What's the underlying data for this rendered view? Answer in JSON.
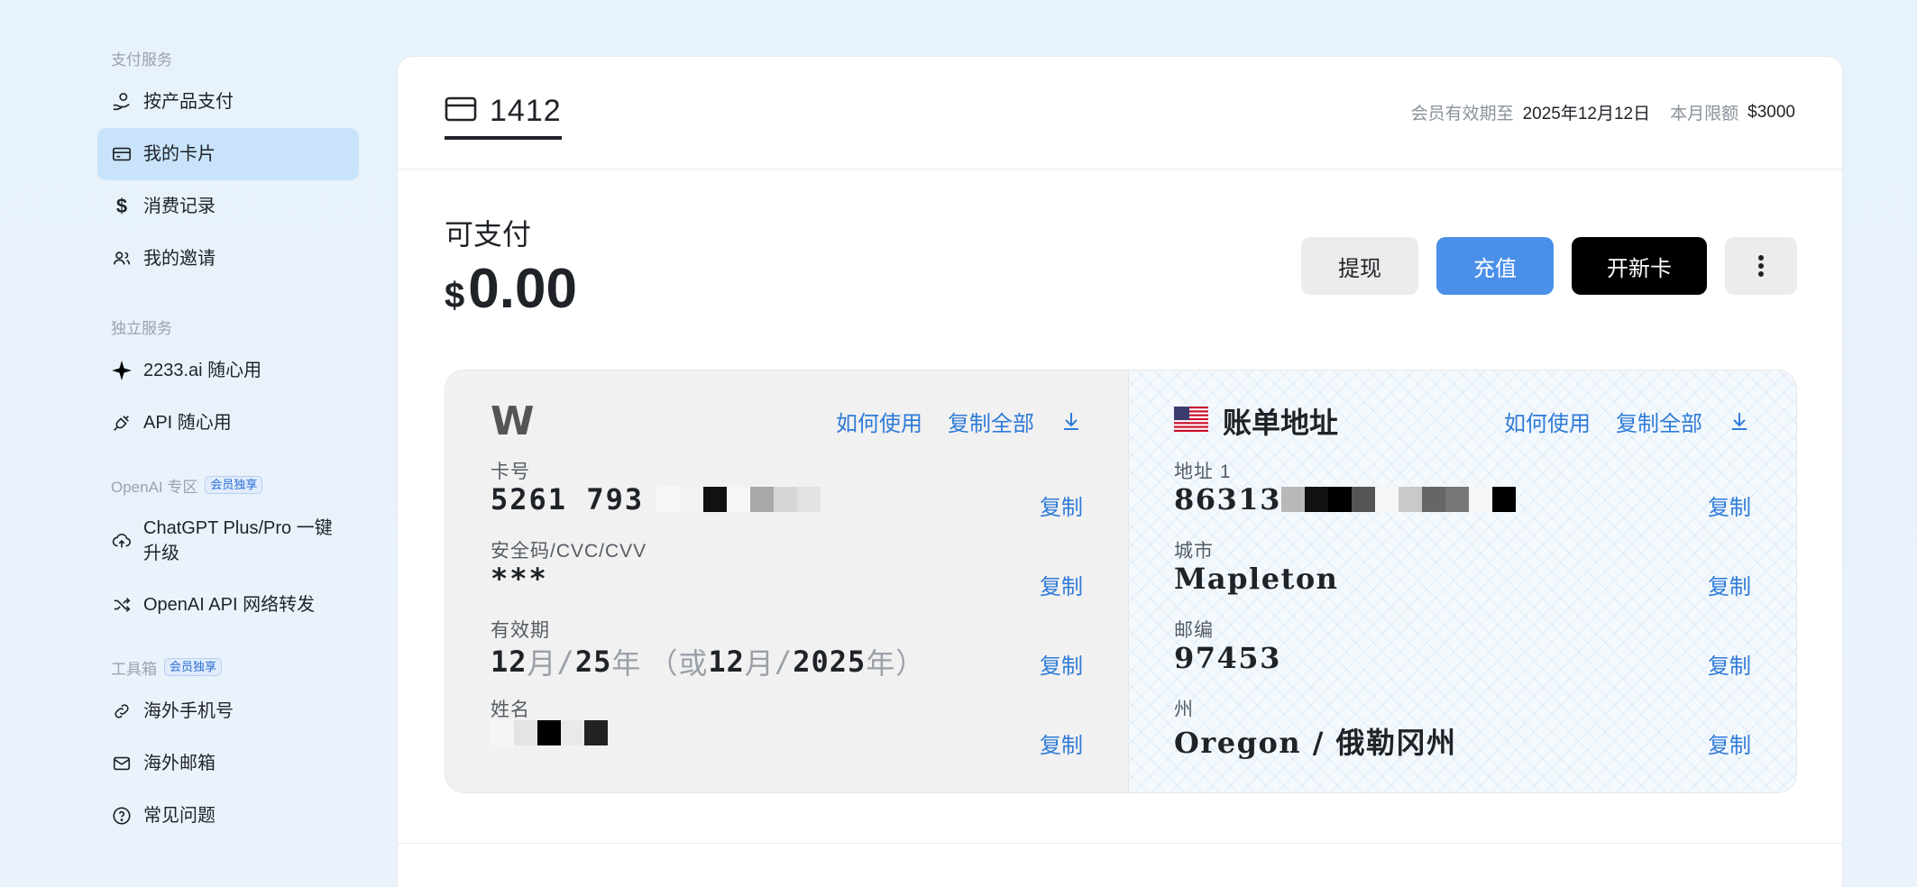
{
  "sidebar": {
    "sections": [
      {
        "label": "支付服务",
        "badge": "",
        "items": [
          {
            "label": "按产品支付",
            "icon": "coin-hand-icon",
            "active": false
          },
          {
            "label": "我的卡片",
            "icon": "card-icon",
            "active": true
          },
          {
            "label": "消费记录",
            "icon": "dollar-icon",
            "active": false
          },
          {
            "label": "我的邀请",
            "icon": "users-icon",
            "active": false
          }
        ]
      },
      {
        "label": "独立服务",
        "badge": "",
        "items": [
          {
            "label": "2233.ai 随心用",
            "icon": "sparkle-icon",
            "active": false
          },
          {
            "label": "API 随心用",
            "icon": "plug-icon",
            "active": false
          }
        ]
      },
      {
        "label": "OpenAI 专区",
        "badge": "会员独享",
        "items": [
          {
            "label": "ChatGPT Plus/Pro 一键升级",
            "icon": "cloud-upload-icon",
            "active": false
          },
          {
            "label": "OpenAI API 网络转发",
            "icon": "shuffle-icon",
            "active": false
          }
        ]
      },
      {
        "label": "工具箱",
        "badge": "会员独享",
        "items": [
          {
            "label": "海外手机号",
            "icon": "link-icon",
            "active": false
          },
          {
            "label": "海外邮箱",
            "icon": "mail-icon",
            "active": false
          },
          {
            "label": "常见问题",
            "icon": "help-icon",
            "active": false
          }
        ]
      }
    ]
  },
  "header": {
    "card_tab": "1412",
    "expiry_label": "会员有效期至",
    "expiry_value": "2025年12月12日",
    "limit_label": "本月限额",
    "limit_value": "$3000"
  },
  "balance": {
    "label": "可支付",
    "currency": "$",
    "amount": "0.00"
  },
  "actions": {
    "withdraw": "提现",
    "topup": "充值",
    "new_card": "开新卡",
    "more": "⋮"
  },
  "card_info": {
    "brand": "W",
    "how_to": "如何使用",
    "copy_all": "复制全部",
    "copy": "复制",
    "number_label": "卡号",
    "number_value": "5261 793",
    "cvc_label": "安全码/CVC/CVV",
    "cvc_value": "***",
    "expiry_label": "有效期",
    "exp_month": "12",
    "exp_month_unit": "月",
    "exp_sep": "/",
    "exp_year_short": "25",
    "exp_year_unit": "年",
    "exp_or": "（或",
    "exp_alt_month": "12",
    "exp_alt_month_unit": "月",
    "exp_alt_sep": "/",
    "exp_alt_year": "2025",
    "exp_alt_year_unit": "年）",
    "name_label": "姓名"
  },
  "billing": {
    "title": "账单地址",
    "how_to": "如何使用",
    "copy_all": "复制全部",
    "copy": "复制",
    "address_label": "地址 1",
    "address_value": "86313",
    "city_label": "城市",
    "city_value": "Mapleton",
    "zip_label": "邮编",
    "zip_value": "97453",
    "state_label": "州",
    "state_value": "Oregon / 俄勒冈州"
  },
  "colors": {
    "accent": "#4a8fe8",
    "link": "#2f7bd8",
    "active_nav": "#c8e3fa"
  }
}
